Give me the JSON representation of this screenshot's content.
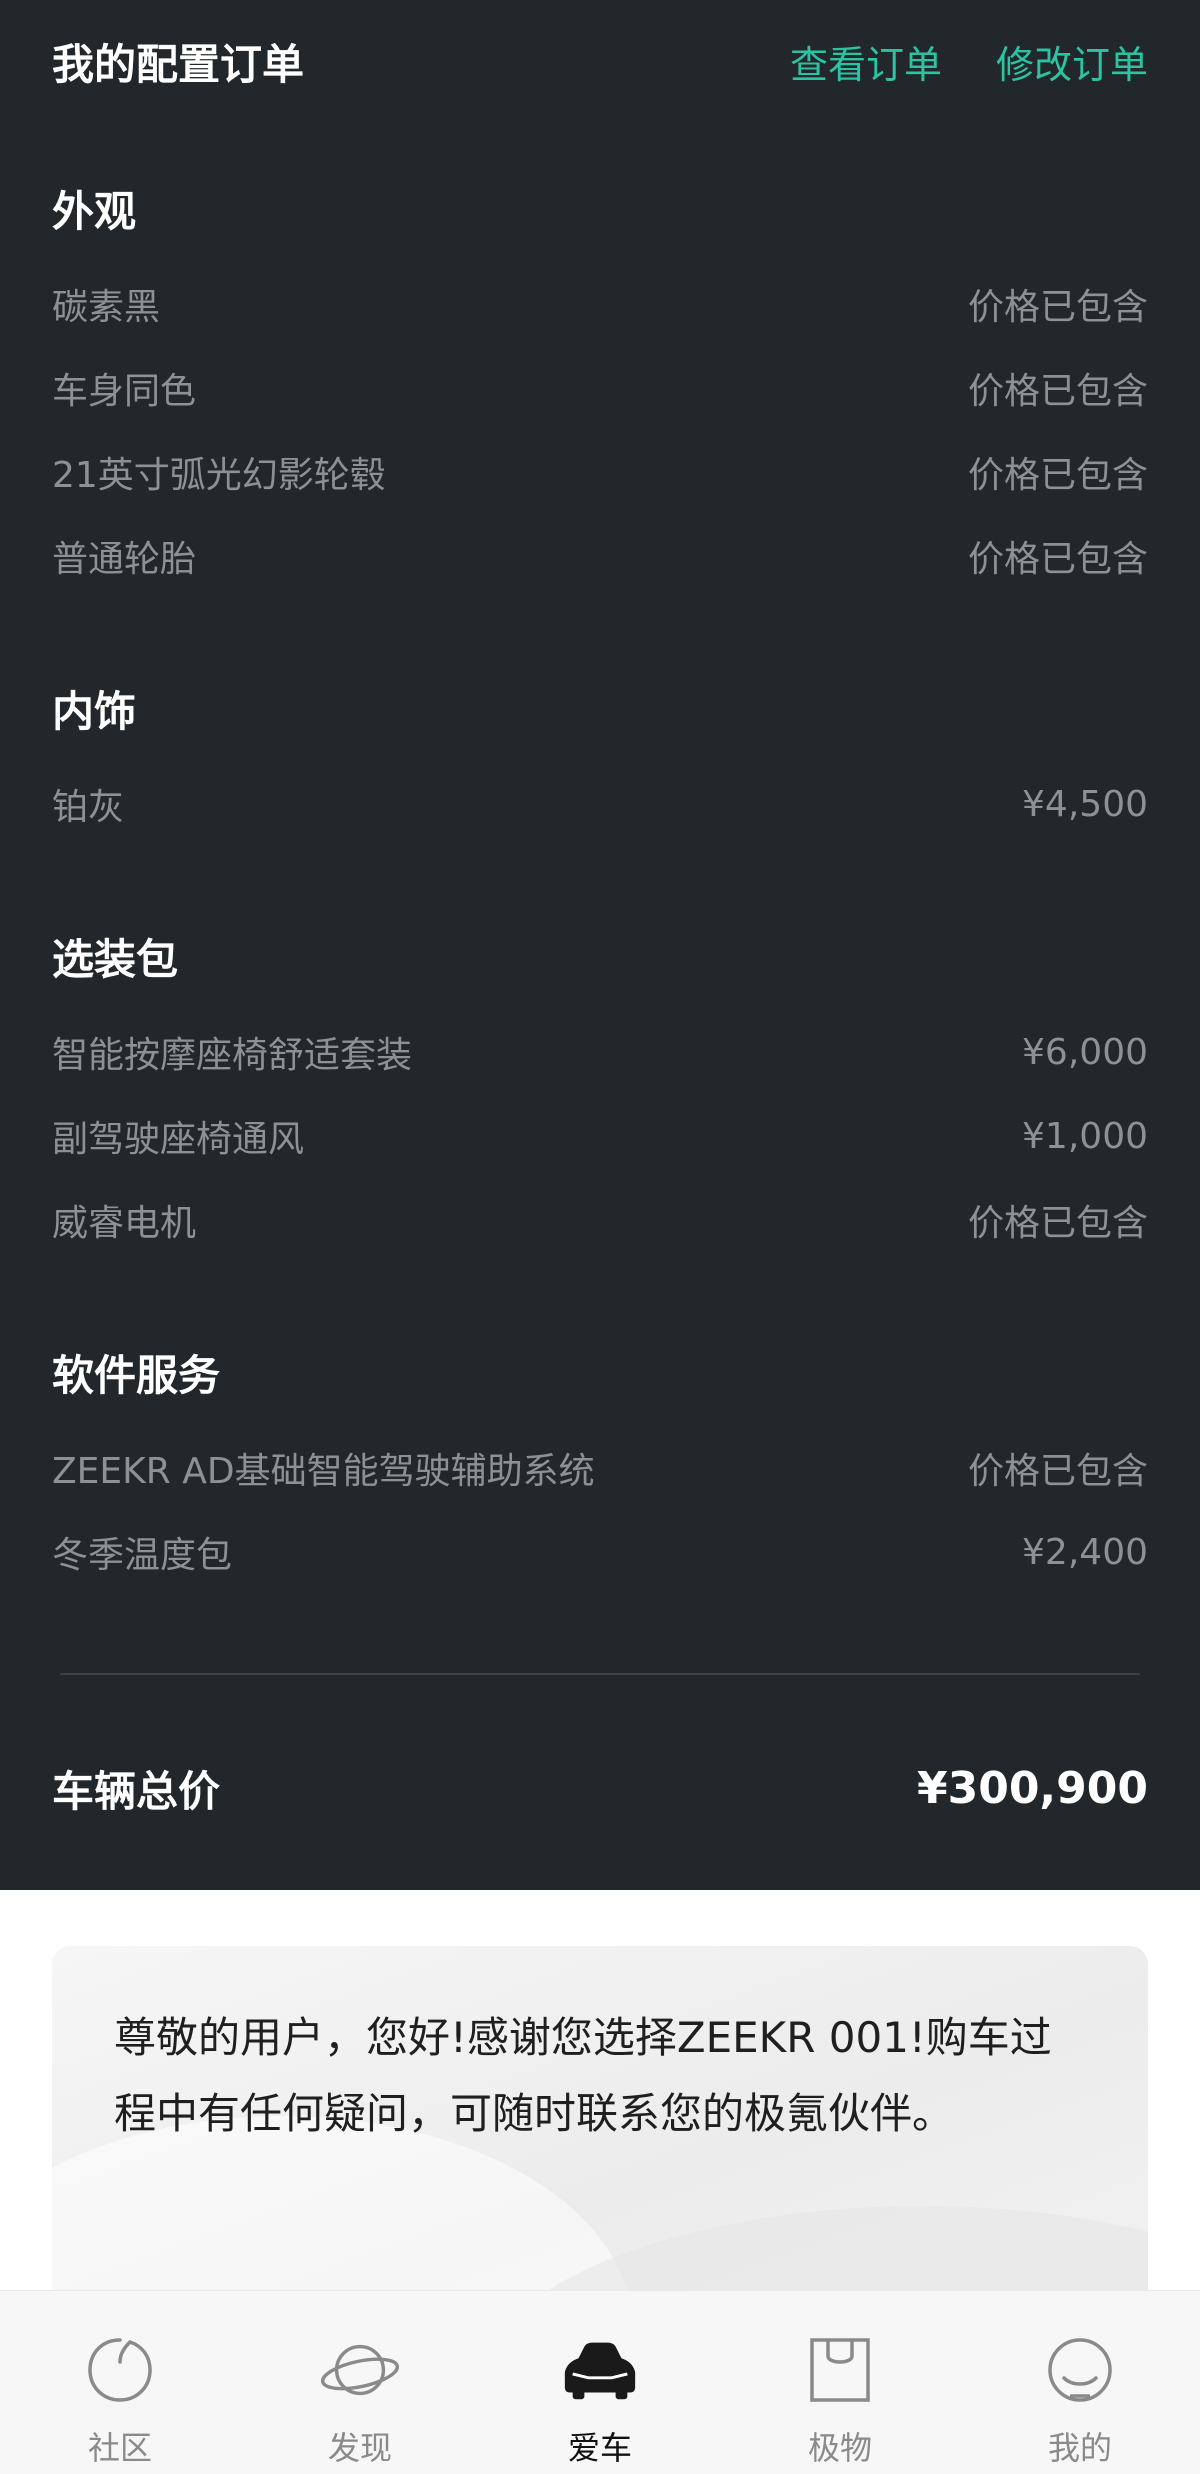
{
  "header": {
    "title": "我的配置订单",
    "view_order": "查看订单",
    "edit_order": "修改订单"
  },
  "sections": [
    {
      "title": "外观",
      "items": [
        {
          "name": "碳素黑",
          "price": "价格已包含"
        },
        {
          "name": "车身同色",
          "price": "价格已包含"
        },
        {
          "name": "21英寸弧光幻影轮毂",
          "price": "价格已包含"
        },
        {
          "name": "普通轮胎",
          "price": "价格已包含"
        }
      ]
    },
    {
      "title": "内饰",
      "items": [
        {
          "name": "铂灰",
          "price": "¥4,500"
        }
      ]
    },
    {
      "title": "选装包",
      "items": [
        {
          "name": "智能按摩座椅舒适套装",
          "price": "¥6,000"
        },
        {
          "name": "副驾驶座椅通风",
          "price": "¥1,000"
        },
        {
          "name": "威睿电机",
          "price": "价格已包含"
        }
      ]
    },
    {
      "title": "软件服务",
      "items": [
        {
          "name": "ZEEKR AD基础智能驾驶辅助系统",
          "price": "价格已包含"
        },
        {
          "name": "冬季温度包",
          "price": "¥2,400"
        }
      ]
    }
  ],
  "total": {
    "label": "车辆总价",
    "value": "¥300,900"
  },
  "notice": {
    "text": "尊敬的用户，您好!感谢您选择ZEEKR 001!购车过程中有任何疑问，可随时联系您的极氪伙伴。"
  },
  "tabbar": {
    "items": [
      {
        "label": "社区",
        "icon": "community-icon",
        "active": false
      },
      {
        "label": "发现",
        "icon": "planet-icon",
        "active": false
      },
      {
        "label": "爱车",
        "icon": "car-icon",
        "active": true
      },
      {
        "label": "极物",
        "icon": "shopping-bag-icon",
        "active": false
      },
      {
        "label": "我的",
        "icon": "profile-icon",
        "active": false
      }
    ]
  },
  "colors": {
    "background_dark": "#22272b",
    "accent": "#2bc3a2",
    "muted_text": "#8c9196"
  }
}
